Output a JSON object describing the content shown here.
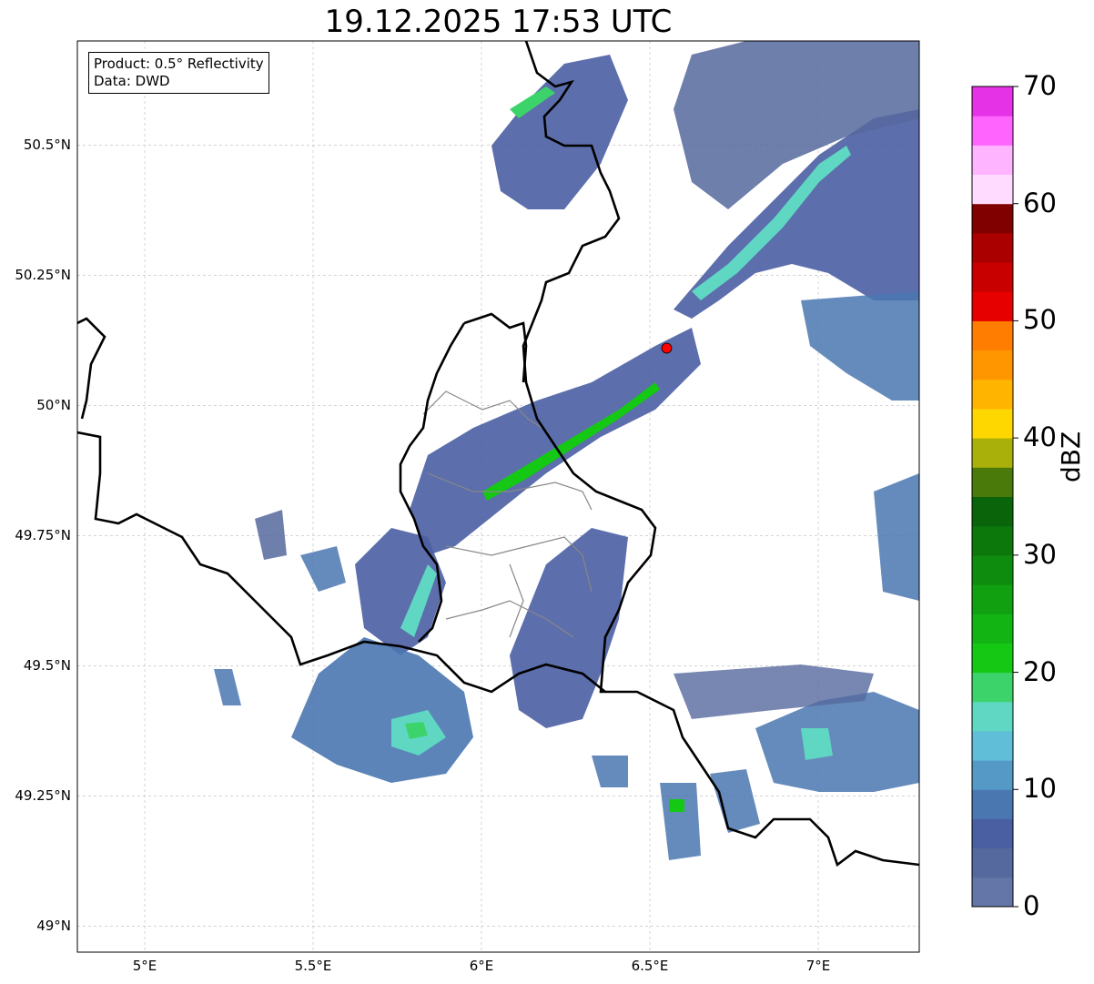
{
  "title": "19.12.2025 17:53 UTC",
  "info": {
    "product": "Product: 0.5° Reflectivity",
    "data": "Data: DWD"
  },
  "axes": {
    "lon_range": [
      4.8,
      7.3
    ],
    "lat_range": [
      48.95,
      50.7
    ],
    "x_ticks": [
      {
        "lon": 5.0,
        "label": "5°E"
      },
      {
        "lon": 5.5,
        "label": "5.5°E"
      },
      {
        "lon": 6.0,
        "label": "6°E"
      },
      {
        "lon": 6.5,
        "label": "6.5°E"
      },
      {
        "lon": 7.0,
        "label": "7°E"
      }
    ],
    "y_ticks": [
      {
        "lat": 50.5,
        "label": "50.5°N"
      },
      {
        "lat": 50.25,
        "label": "50.25°N"
      },
      {
        "lat": 50.0,
        "label": "50°N"
      },
      {
        "lat": 49.75,
        "label": "49.75°N"
      },
      {
        "lat": 49.5,
        "label": "49.5°N"
      },
      {
        "lat": 49.25,
        "label": "49.25°N"
      },
      {
        "lat": 49.0,
        "label": "49°N"
      }
    ],
    "grid": true
  },
  "radar_site": {
    "lon": 6.55,
    "lat": 50.11,
    "color": "#ff0000"
  },
  "colorbar": {
    "label": "dBZ",
    "min": 0,
    "max": 70,
    "ticks": [
      "0",
      "10",
      "20",
      "30",
      "40",
      "50",
      "60",
      "70"
    ],
    "colors": [
      "#6476a8",
      "#56699e",
      "#4a5ea2",
      "#4a77b0",
      "#559ac6",
      "#60bed8",
      "#5fd7c3",
      "#3cd46a",
      "#14c814",
      "#12b414",
      "#10a010",
      "#0e8c0e",
      "#0c780c",
      "#0a640a",
      "#4a7a0a",
      "#aab00a",
      "#ffd700",
      "#ffb400",
      "#ff9600",
      "#ff7d00",
      "#e60000",
      "#c80000",
      "#aa0000",
      "#800000",
      "#ffdcff",
      "#ffb4ff",
      "#ff64ff",
      "#e632e6"
    ]
  },
  "legend_position": "top-left"
}
